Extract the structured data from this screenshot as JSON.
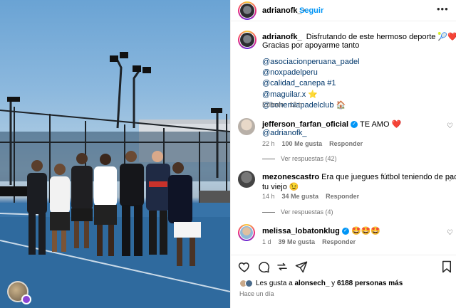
{
  "post": {
    "username": "adrianofk_",
    "follow_label": "Seguir",
    "more_icon": "more-icon",
    "caption_text": "Disfrutando de este hermoso deporte 🎾❤️",
    "caption_line2": "Gracias por apoyarme tanto",
    "mentions": [
      "@asociacionperuana_padel",
      "@noxpadelperu",
      "@calidad_canepa #1",
      "@maguilar.x ⭐",
      "@bohemiapadelclub 🏠"
    ],
    "edited_meta": "Editado · 12 h"
  },
  "comments": [
    {
      "username": "jefferson_farfan_oficial",
      "text": "TE AMO ❤️",
      "line2": "@adrianofk_",
      "time": "22 h",
      "likes": "100 Me gusta",
      "reply": "Responder",
      "view_replies": "Ver respuestas (42)"
    },
    {
      "username": "mezonescastro",
      "text": "Era que juegues fútbol teniendo de padrino a",
      "line2": "tu viejo 😉",
      "time": "14 h",
      "likes": "34 Me gusta",
      "reply": "Responder",
      "view_replies": "Ver respuestas (4)"
    },
    {
      "username": "melissa_lobatonklug",
      "text": "🤩🤩🤩",
      "time": "1 d",
      "likes": "39 Me gusta",
      "reply": "Responder"
    }
  ],
  "footer": {
    "likes_prefix": "Les gusta a ",
    "likes_user": "alonsech_",
    "likes_suffix": " y ",
    "likes_count": "6188 personas más",
    "time_ago": "Hace un día"
  },
  "colors": {
    "link": "#00376b",
    "accent": "#0095f6",
    "meta": "#737373"
  }
}
